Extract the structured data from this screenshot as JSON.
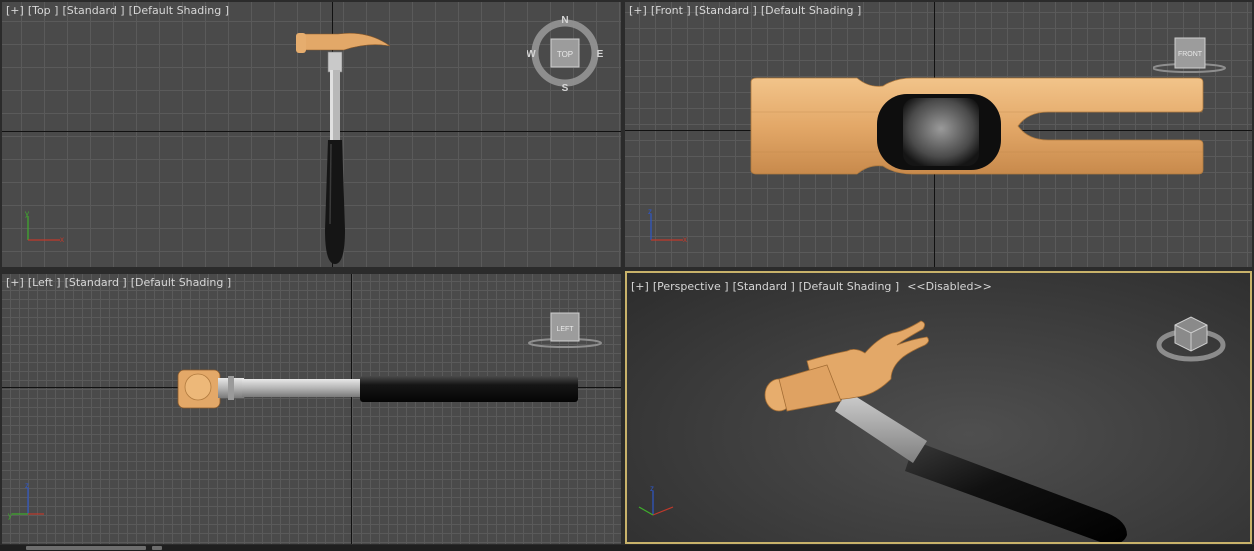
{
  "viewports": {
    "top": {
      "menu": "[+]",
      "view": "[Top ]",
      "style": "[Standard ]",
      "shading": "[Default Shading ]"
    },
    "front": {
      "menu": "[+]",
      "view": "[Front ]",
      "style": "[Standard ]",
      "shading": "[Default Shading ]"
    },
    "left": {
      "menu": "[+]",
      "view": "[Left ]",
      "style": "[Standard ]",
      "shading": "[Default Shading ]"
    },
    "perspective": {
      "menu": "[+]",
      "view": "[Perspective ]",
      "style": "[Standard ]",
      "shading": "[Default Shading ]",
      "extra": "<<Disabled>>"
    }
  },
  "viewcube": {
    "top_face": "TOP",
    "front_face": "FRONT",
    "left_face": "LEFT",
    "compass": {
      "north": "N",
      "south": "S",
      "east": "E",
      "west": "W"
    }
  },
  "axes": {
    "x": "x",
    "y": "y",
    "z": "z"
  },
  "colors": {
    "active_border": "#c8b26a",
    "wood": "#e3a868",
    "handle_black": "#151515",
    "steel": "#b8b8b8",
    "axis_x": "#c0392b",
    "axis_y": "#3fae2c",
    "axis_z": "#2e57c9"
  },
  "icons": [
    "compass-viewcube-icon",
    "viewcube-icon",
    "axis-tripod-icon"
  ]
}
